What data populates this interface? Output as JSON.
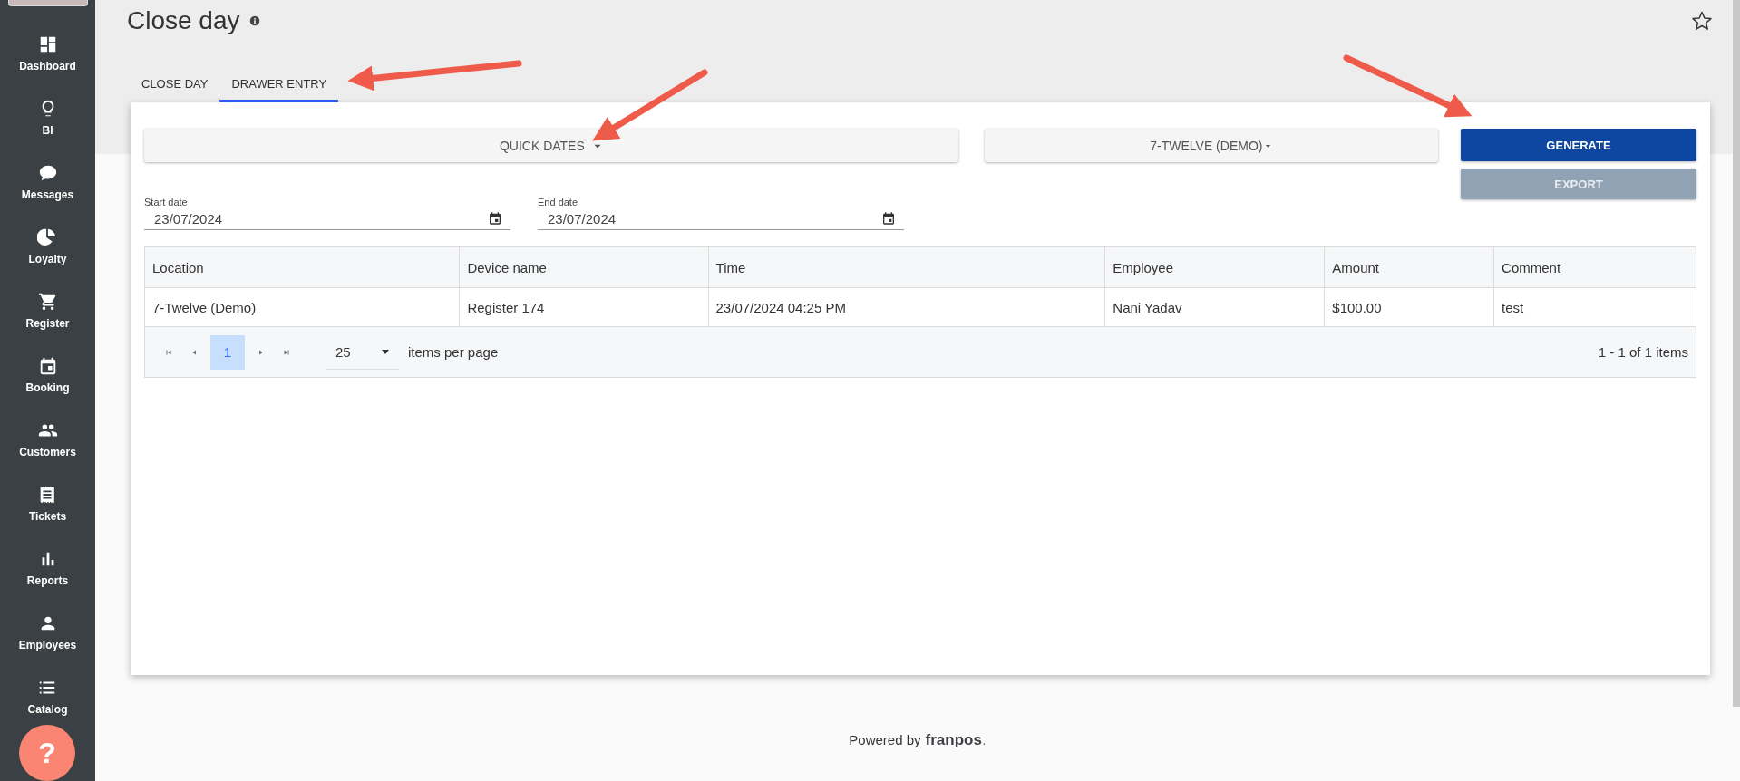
{
  "sidebar": {
    "items": [
      {
        "label": "Dashboard"
      },
      {
        "label": "BI"
      },
      {
        "label": "Messages"
      },
      {
        "label": "Loyalty"
      },
      {
        "label": "Register"
      },
      {
        "label": "Booking"
      },
      {
        "label": "Customers"
      },
      {
        "label": "Tickets"
      },
      {
        "label": "Reports"
      },
      {
        "label": "Employees"
      },
      {
        "label": "Catalog"
      }
    ],
    "help_button": "?"
  },
  "page": {
    "title": "Close day"
  },
  "tabs": [
    {
      "label": "CLOSE DAY",
      "selected": false
    },
    {
      "label": "DRAWER ENTRY",
      "selected": true
    }
  ],
  "filters": {
    "quick_dates": "QUICK DATES",
    "location": "7-TWELVE (DEMO)",
    "generate": "GENERATE",
    "export": {
      "label": "EXPORT",
      "disabled": true
    },
    "start_date": {
      "label": "Start date",
      "value": "23/07/2024"
    },
    "end_date": {
      "label": "End date",
      "value": "23/07/2024"
    }
  },
  "table": {
    "columns": [
      "Location",
      "Device name",
      "Time",
      "Employee",
      "Amount",
      "Comment"
    ],
    "rows": [
      [
        "7-Twelve (Demo)",
        "Register 174",
        "23/07/2024 04:25 PM",
        "Nani Yadav",
        "$100.00",
        "test"
      ]
    ]
  },
  "pager": {
    "pages": [
      {
        "label": "1",
        "selected": true
      }
    ],
    "page_size": "25",
    "page_size_label": "items per page",
    "summary": "1 - 1 of 1 items"
  },
  "footer": {
    "text": "Powered by",
    "brand": "franpos",
    "brand_dot": "."
  }
}
